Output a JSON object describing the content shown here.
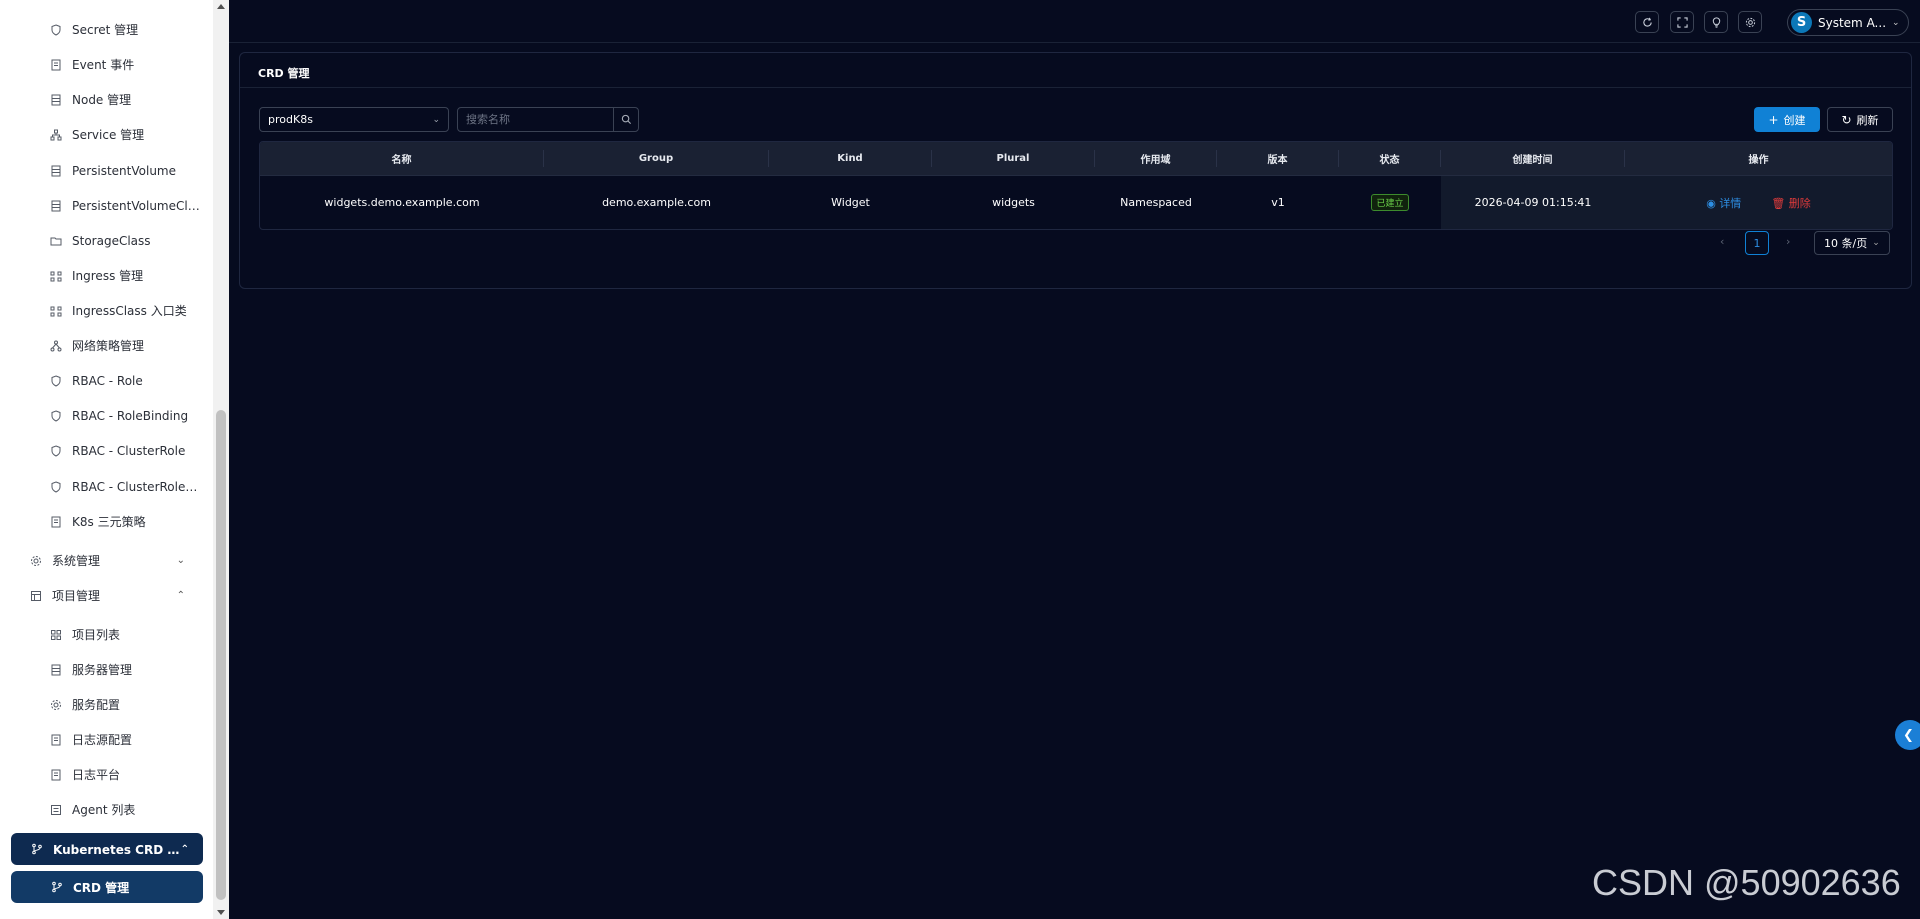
{
  "sidebar": {
    "sub_items": [
      {
        "label": "Secret 管理",
        "icon": "shield-icon"
      },
      {
        "label": "Event 事件",
        "icon": "doc-icon"
      },
      {
        "label": "Node 管理",
        "icon": "server-icon"
      },
      {
        "label": "Service 管理",
        "icon": "network-icon"
      },
      {
        "label": "PersistentVolume",
        "icon": "server-icon"
      },
      {
        "label": "PersistentVolumeClai...",
        "icon": "server-icon"
      },
      {
        "label": "StorageClass",
        "icon": "folder-icon"
      },
      {
        "label": "Ingress 管理",
        "icon": "route-icon"
      },
      {
        "label": "IngressClass 入口类",
        "icon": "route-icon"
      },
      {
        "label": "网络策略管理",
        "icon": "tree-icon"
      },
      {
        "label": "RBAC - Role",
        "icon": "shield-icon"
      },
      {
        "label": "RBAC - RoleBinding",
        "icon": "shield-icon"
      },
      {
        "label": "RBAC - ClusterRole",
        "icon": "shield-icon"
      },
      {
        "label": "RBAC - ClusterRoleBi...",
        "icon": "shield-icon"
      },
      {
        "label": "K8s 三元策略",
        "icon": "doc-icon"
      }
    ],
    "groups": {
      "system": {
        "label": "系统管理",
        "icon": "gear-icon"
      },
      "project": {
        "label": "项目管理",
        "icon": "layout-icon"
      }
    },
    "project_items": [
      {
        "label": "项目列表",
        "icon": "grid-icon"
      },
      {
        "label": "服务器管理",
        "icon": "server-icon"
      },
      {
        "label": "服务配置",
        "icon": "gear-icon"
      },
      {
        "label": "日志源配置",
        "icon": "doc-icon"
      },
      {
        "label": "日志平台",
        "icon": "doc-icon"
      },
      {
        "label": "Agent 列表",
        "icon": "list-icon"
      }
    ],
    "crd_group": {
      "label": "Kubernetes CRD 管理",
      "icon": "branch-icon"
    },
    "crd_item": {
      "label": "CRD 管理",
      "icon": "branch-icon"
    }
  },
  "topbar": {
    "user_initial": "S",
    "user_name": "System A..."
  },
  "card": {
    "title": "CRD 管理",
    "cluster_select": "prodK8s",
    "search_placeholder": "搜索名称",
    "create_label": "创建",
    "refresh_label": "刷新"
  },
  "table": {
    "headers": [
      "名称",
      "Group",
      "Kind",
      "Plural",
      "作用域",
      "版本",
      "状态",
      "创建时间",
      "操作"
    ],
    "rows": [
      {
        "name": "widgets.demo.example.com",
        "group": "demo.example.com",
        "kind": "Widget",
        "plural": "widgets",
        "scope": "Namespaced",
        "version": "v1",
        "status": "已建立",
        "created": "2026-04-09 01:15:41",
        "detail": "详情",
        "delete": "删除"
      }
    ]
  },
  "pagination": {
    "current_page": "1",
    "page_size": "10 条/页"
  },
  "watermark": "CSDN @50902636",
  "colors": {
    "accent": "#1081d5",
    "background": "#060b1f",
    "status_ok": "#6bd14a",
    "danger": "#e03b3b"
  }
}
